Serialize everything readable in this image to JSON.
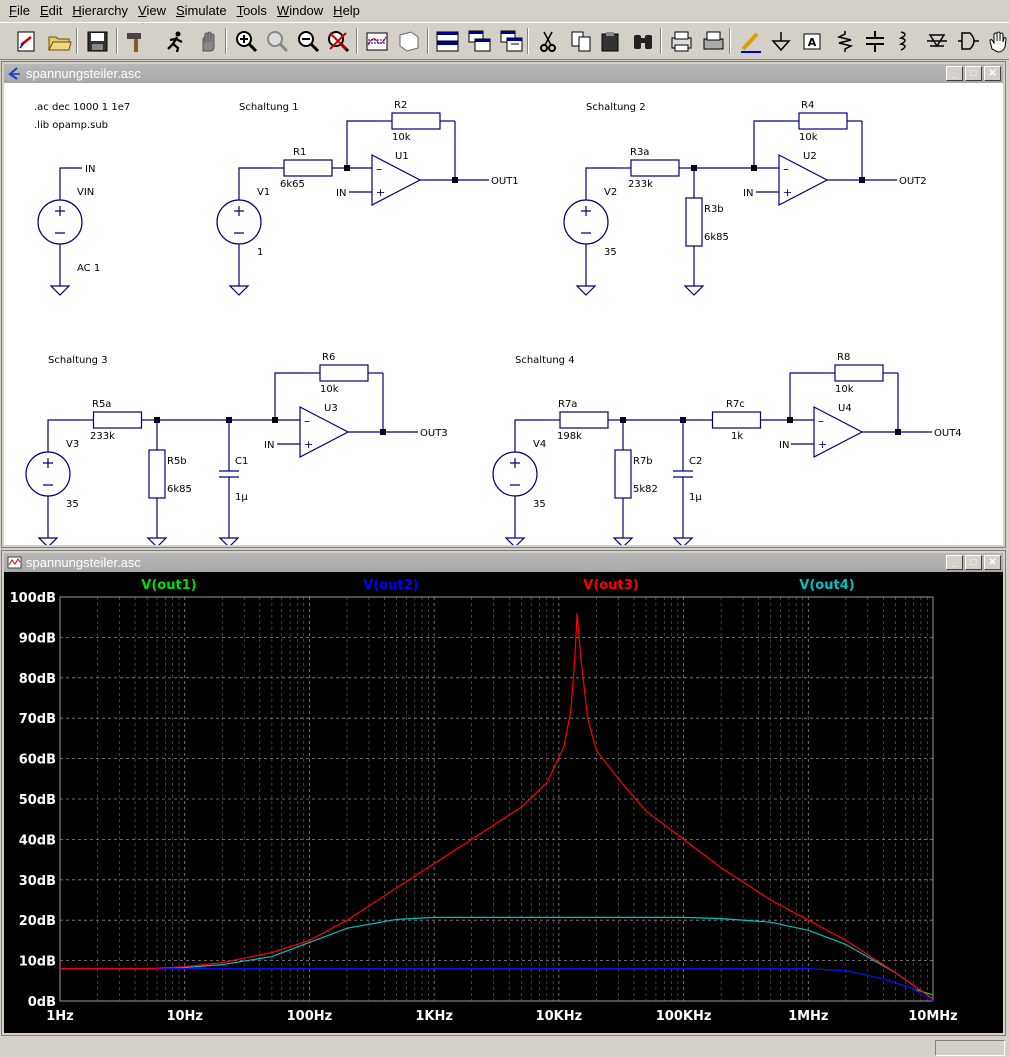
{
  "menu": [
    {
      "label": "File",
      "key": "F"
    },
    {
      "label": "Edit",
      "key": "E"
    },
    {
      "label": "Hierarchy",
      "key": "H"
    },
    {
      "label": "View",
      "key": "V"
    },
    {
      "label": "Simulate",
      "key": "S"
    },
    {
      "label": "Tools",
      "key": "T"
    },
    {
      "label": "Window",
      "key": "W"
    },
    {
      "label": "Help",
      "key": "H"
    }
  ],
  "toolbar_icons": [
    "new-schematic-icon",
    "open-icon",
    "save-icon",
    "control-panel-hammer-icon",
    "run-simulation-icon",
    "halt-icon",
    "zoom-in-icon",
    "pan-icon",
    "zoom-out-icon",
    "zoom-fit-icon",
    "autorange-plot-icon",
    "plot-settings-icon",
    "tile-windows-icon",
    "cascade-windows-icon",
    "close-windows-icon",
    "cut-icon",
    "copy-icon",
    "paste-icon",
    "find-icon",
    "print-preview-icon",
    "print-icon",
    "draw-wire-icon",
    "ground-icon",
    "label-net-icon",
    "resistor-icon",
    "capacitor-icon",
    "inductor-icon",
    "diode-icon",
    "component-icon",
    "move-hand-icon"
  ],
  "schematic_window": {
    "title": "spannungsteiler.asc",
    "directives": [
      ".ac dec 1000 1 1e7",
      ".lib opamp.sub"
    ],
    "vin": {
      "net": "IN",
      "name": "VIN",
      "value": "AC 1"
    },
    "circuits": [
      {
        "title": "Schaltung 1",
        "source": {
          "name": "V1",
          "value": "1"
        },
        "in_label": "IN",
        "opamp": "U1",
        "out": "OUT1",
        "parts": [
          {
            "name": "R1",
            "value": "6k65"
          },
          {
            "name": "R2",
            "value": "10k"
          }
        ]
      },
      {
        "title": "Schaltung 2",
        "source": {
          "name": "V2",
          "value": "35"
        },
        "in_label": "IN",
        "opamp": "U2",
        "out": "OUT2",
        "parts": [
          {
            "name": "R3a",
            "value": "233k"
          },
          {
            "name": "R3b",
            "value": "6k85"
          },
          {
            "name": "R4",
            "value": "10k"
          }
        ]
      },
      {
        "title": "Schaltung 3",
        "source": {
          "name": "V3",
          "value": "35"
        },
        "in_label": "IN",
        "opamp": "U3",
        "out": "OUT3",
        "parts": [
          {
            "name": "R5a",
            "value": "233k"
          },
          {
            "name": "R5b",
            "value": "6k85"
          },
          {
            "name": "C1",
            "value": "1µ"
          },
          {
            "name": "R6",
            "value": "10k"
          }
        ]
      },
      {
        "title": "Schaltung 4",
        "source": {
          "name": "V4",
          "value": "35"
        },
        "in_label": "IN",
        "opamp": "U4",
        "out": "OUT4",
        "parts": [
          {
            "name": "R7a",
            "value": "198k"
          },
          {
            "name": "R7b",
            "value": "5k82"
          },
          {
            "name": "C2",
            "value": "1µ"
          },
          {
            "name": "R7c",
            "value": "1k"
          },
          {
            "name": "R8",
            "value": "10k"
          }
        ]
      }
    ]
  },
  "plot_window": {
    "title": "spannungsteiler.asc",
    "window_buttons": [
      "_",
      "□",
      "×"
    ]
  },
  "chart_data": {
    "type": "line",
    "x_scale": "log",
    "x_ticks": [
      {
        "x": 1,
        "label": "1Hz"
      },
      {
        "x": 10,
        "label": "10Hz"
      },
      {
        "x": 100,
        "label": "100Hz"
      },
      {
        "x": 1000,
        "label": "1KHz"
      },
      {
        "x": 10000,
        "label": "10KHz"
      },
      {
        "x": 100000,
        "label": "100KHz"
      },
      {
        "x": 1000000,
        "label": "1MHz"
      },
      {
        "x": 10000000,
        "label": "10MHz"
      }
    ],
    "y_ticks": [
      {
        "y": 0,
        "label": "0dB"
      },
      {
        "y": 10,
        "label": "10dB"
      },
      {
        "y": 20,
        "label": "20dB"
      },
      {
        "y": 30,
        "label": "30dB"
      },
      {
        "y": 40,
        "label": "40dB"
      },
      {
        "y": 50,
        "label": "50dB"
      },
      {
        "y": 60,
        "label": "60dB"
      },
      {
        "y": 70,
        "label": "70dB"
      },
      {
        "y": 80,
        "label": "80dB"
      },
      {
        "y": 90,
        "label": "90dB"
      },
      {
        "y": 100,
        "label": "100dB"
      }
    ],
    "xlim": [
      1,
      10000000
    ],
    "ylim": [
      0,
      100
    ],
    "grid": true,
    "background": "#000000",
    "series": [
      {
        "name": "V(out1)",
        "color": "#00e000",
        "x": [
          1,
          10,
          100,
          1000,
          10000,
          100000,
          1000000,
          2000000,
          4000000,
          7000000,
          10000000
        ],
        "y": [
          8,
          8,
          8,
          8,
          8,
          8,
          8,
          7.5,
          5.5,
          3,
          1.5
        ]
      },
      {
        "name": "V(out2)",
        "color": "#0000ff",
        "x": [
          1,
          10,
          100,
          1000,
          10000,
          100000,
          1000000,
          2000000,
          4000000,
          7000000,
          10000000
        ],
        "y": [
          8,
          8,
          8,
          8,
          8,
          8,
          8,
          7.5,
          5.5,
          3,
          0
        ]
      },
      {
        "name": "V(out3)",
        "color": "#ff0000",
        "x": [
          1,
          5,
          10,
          20,
          50,
          100,
          200,
          500,
          1000,
          2000,
          5000,
          8000,
          11000,
          12500,
          13500,
          14000,
          15000,
          17000,
          20000,
          30000,
          50000,
          100000,
          200000,
          500000,
          1000000,
          2000000,
          5000000,
          10000000
        ],
        "y": [
          8,
          8,
          8.5,
          9.5,
          12,
          15,
          20,
          28,
          34,
          40,
          48,
          54,
          63,
          72,
          86,
          96,
          85,
          70,
          62,
          55,
          47,
          40,
          33,
          25,
          20,
          15,
          7,
          0.5
        ]
      },
      {
        "name": "V(out4)",
        "color": "#00c0c0",
        "x": [
          1,
          5,
          10,
          20,
          50,
          100,
          200,
          500,
          1000,
          10000,
          100000,
          200000,
          500000,
          1000000,
          2000000,
          5000000,
          10000000
        ],
        "y": [
          8,
          8,
          8.3,
          9,
          11,
          14.5,
          18,
          20.2,
          20.7,
          20.7,
          20.7,
          20.4,
          19.5,
          17.5,
          14,
          7,
          0.5
        ]
      }
    ]
  }
}
